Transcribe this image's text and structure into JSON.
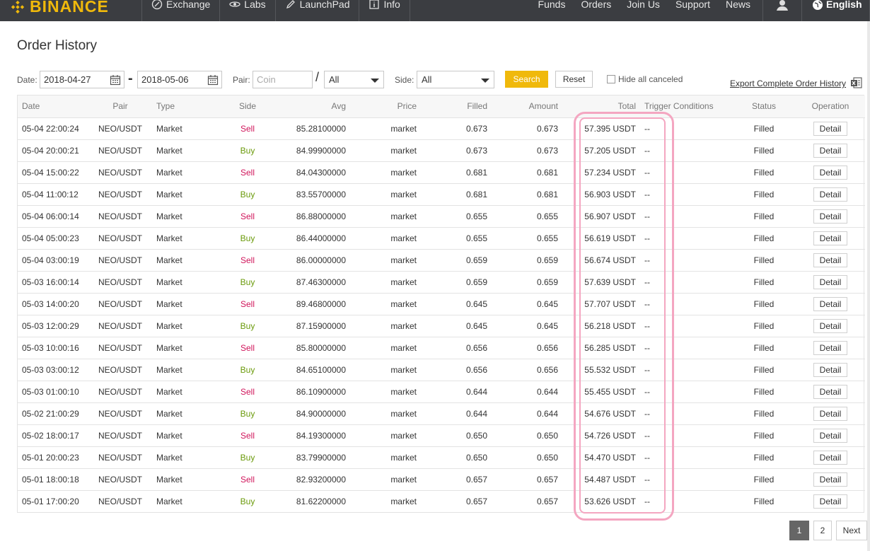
{
  "nav": {
    "brand": "BINANCE",
    "left": [
      {
        "label": "Exchange",
        "icon": "exchange-icon"
      },
      {
        "label": "Labs",
        "icon": "labs-icon"
      },
      {
        "label": "LaunchPad",
        "icon": "launchpad-icon"
      },
      {
        "label": "Info",
        "icon": "info-icon"
      }
    ],
    "right": [
      "Funds",
      "Orders",
      "Join Us",
      "Support",
      "News"
    ],
    "language": "English"
  },
  "page": {
    "title": "Order History"
  },
  "filters": {
    "date_label": "Date:",
    "date_from": "2018-04-27",
    "date_to": "2018-05-06",
    "pair_label": "Pair:",
    "coin_placeholder": "Coin",
    "quote_value": "All",
    "side_label": "Side:",
    "side_value": "All",
    "search_label": "Search",
    "reset_label": "Reset",
    "hide_canceled_label": "Hide all canceled",
    "export_label": "Export Complete Order History"
  },
  "table": {
    "headers": [
      "Date",
      "Pair",
      "Type",
      "Side",
      "Avg",
      "Price",
      "Filled",
      "Amount",
      "Total",
      "Trigger Conditions",
      "Status",
      "Operation"
    ],
    "rows": [
      [
        "05-04 22:00:24",
        "NEO/USDT",
        "Market",
        "Sell",
        "85.28100000",
        "market",
        "0.673",
        "0.673",
        "57.395 USDT",
        "--",
        "Filled",
        "Detail"
      ],
      [
        "05-04 20:00:21",
        "NEO/USDT",
        "Market",
        "Buy",
        "84.99900000",
        "market",
        "0.673",
        "0.673",
        "57.205 USDT",
        "--",
        "Filled",
        "Detail"
      ],
      [
        "05-04 15:00:22",
        "NEO/USDT",
        "Market",
        "Sell",
        "84.04300000",
        "market",
        "0.681",
        "0.681",
        "57.234 USDT",
        "--",
        "Filled",
        "Detail"
      ],
      [
        "05-04 11:00:12",
        "NEO/USDT",
        "Market",
        "Buy",
        "83.55700000",
        "market",
        "0.681",
        "0.681",
        "56.903 USDT",
        "--",
        "Filled",
        "Detail"
      ],
      [
        "05-04 06:00:14",
        "NEO/USDT",
        "Market",
        "Sell",
        "86.88000000",
        "market",
        "0.655",
        "0.655",
        "56.907 USDT",
        "--",
        "Filled",
        "Detail"
      ],
      [
        "05-04 05:00:23",
        "NEO/USDT",
        "Market",
        "Buy",
        "86.44000000",
        "market",
        "0.655",
        "0.655",
        "56.619 USDT",
        "--",
        "Filled",
        "Detail"
      ],
      [
        "05-04 03:00:19",
        "NEO/USDT",
        "Market",
        "Sell",
        "86.00000000",
        "market",
        "0.659",
        "0.659",
        "56.674 USDT",
        "--",
        "Filled",
        "Detail"
      ],
      [
        "05-03 16:00:14",
        "NEO/USDT",
        "Market",
        "Buy",
        "87.46300000",
        "market",
        "0.659",
        "0.659",
        "57.639 USDT",
        "--",
        "Filled",
        "Detail"
      ],
      [
        "05-03 14:00:20",
        "NEO/USDT",
        "Market",
        "Sell",
        "89.46800000",
        "market",
        "0.645",
        "0.645",
        "57.707 USDT",
        "--",
        "Filled",
        "Detail"
      ],
      [
        "05-03 12:00:29",
        "NEO/USDT",
        "Market",
        "Buy",
        "87.15900000",
        "market",
        "0.645",
        "0.645",
        "56.218 USDT",
        "--",
        "Filled",
        "Detail"
      ],
      [
        "05-03 10:00:16",
        "NEO/USDT",
        "Market",
        "Sell",
        "85.80000000",
        "market",
        "0.656",
        "0.656",
        "56.285 USDT",
        "--",
        "Filled",
        "Detail"
      ],
      [
        "05-03 03:00:12",
        "NEO/USDT",
        "Market",
        "Buy",
        "84.65100000",
        "market",
        "0.656",
        "0.656",
        "55.532 USDT",
        "--",
        "Filled",
        "Detail"
      ],
      [
        "05-03 01:00:10",
        "NEO/USDT",
        "Market",
        "Sell",
        "86.10900000",
        "market",
        "0.644",
        "0.644",
        "55.455 USDT",
        "--",
        "Filled",
        "Detail"
      ],
      [
        "05-02 21:00:29",
        "NEO/USDT",
        "Market",
        "Buy",
        "84.90000000",
        "market",
        "0.644",
        "0.644",
        "54.676 USDT",
        "--",
        "Filled",
        "Detail"
      ],
      [
        "05-02 18:00:17",
        "NEO/USDT",
        "Market",
        "Sell",
        "84.19300000",
        "market",
        "0.650",
        "0.650",
        "54.726 USDT",
        "--",
        "Filled",
        "Detail"
      ],
      [
        "05-01 20:00:23",
        "NEO/USDT",
        "Market",
        "Buy",
        "83.79900000",
        "market",
        "0.650",
        "0.650",
        "54.470 USDT",
        "--",
        "Filled",
        "Detail"
      ],
      [
        "05-01 18:00:18",
        "NEO/USDT",
        "Market",
        "Sell",
        "82.93200000",
        "market",
        "0.657",
        "0.657",
        "54.487 USDT",
        "--",
        "Filled",
        "Detail"
      ],
      [
        "05-01 17:00:20",
        "NEO/USDT",
        "Market",
        "Buy",
        "81.62200000",
        "market",
        "0.657",
        "0.657",
        "53.626 USDT",
        "--",
        "Filled",
        "Detail"
      ]
    ]
  },
  "pagination": {
    "pages": [
      "1",
      "2"
    ],
    "current": "1",
    "next_label": "Next"
  },
  "colors": {
    "brand": "#f0b90b",
    "nav_bg": "#3b3d41",
    "sell": "#d0145a",
    "buy": "#6a9a0a",
    "highlight": "#f4a6c1"
  }
}
